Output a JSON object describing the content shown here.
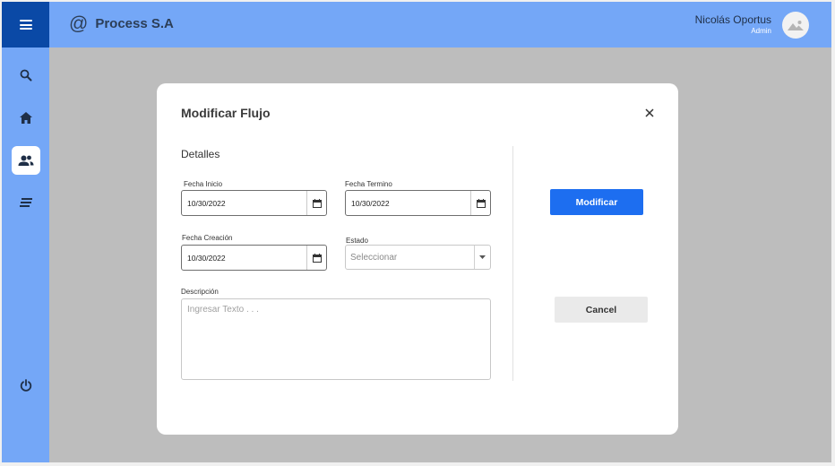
{
  "app": {
    "brand_symbol": "@",
    "brand_name": "Process S.A"
  },
  "user": {
    "name": "Nicolás Oportus",
    "role": "Admin"
  },
  "sidebar": {
    "items": [
      {
        "icon": "search-icon",
        "active": false
      },
      {
        "icon": "home-icon",
        "active": false
      },
      {
        "icon": "users-icon",
        "active": true
      },
      {
        "icon": "list-icon",
        "active": false
      },
      {
        "icon": "power-icon",
        "active": false
      }
    ]
  },
  "modal": {
    "title": "Modificar Flujo",
    "section_title": "Detalles",
    "fields": {
      "fecha_inicio": {
        "label": "Fecha Inicio",
        "value": "10/30/2022"
      },
      "fecha_termino": {
        "label": "Fecha Termino",
        "value": "10/30/2022"
      },
      "fecha_creacion": {
        "label": "Fecha Creación",
        "value": "10/30/2022"
      },
      "estado": {
        "label": "Estado",
        "placeholder": "Seleccionar"
      },
      "descripcion": {
        "label": "Descripción",
        "placeholder": "Ingresar Texto . . ."
      }
    },
    "primary_button": "Modificar",
    "secondary_button": "Cancel"
  },
  "colors": {
    "sidebar": "#74a7f7",
    "menu_button": "#0a49a6",
    "primary": "#1d6ef0",
    "overlay": "#bdbdbd"
  }
}
